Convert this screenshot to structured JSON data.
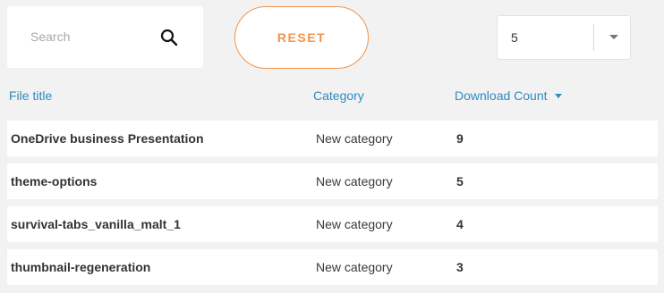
{
  "search": {
    "placeholder": "Search",
    "value": ""
  },
  "reset_button": {
    "label": "RESET"
  },
  "per_page": {
    "selected": "5"
  },
  "table": {
    "columns": {
      "title": "File title",
      "category": "Category",
      "download_count": "Download Count"
    },
    "sort": {
      "column": "download_count",
      "direction": "descending"
    },
    "rows": [
      {
        "title": "OneDrive business Presentation",
        "category": "New category",
        "download_count": "9"
      },
      {
        "title": "theme-options",
        "category": "New category",
        "download_count": "5"
      },
      {
        "title": "survival-tabs_vanilla_malt_1",
        "category": "New category",
        "download_count": "4"
      },
      {
        "title": "thumbnail-regeneration",
        "category": "New category",
        "download_count": "3"
      }
    ]
  },
  "colors": {
    "accent_orange": "#f2934a",
    "header_blue": "#2e8bc0",
    "background": "#f2f2f2"
  }
}
